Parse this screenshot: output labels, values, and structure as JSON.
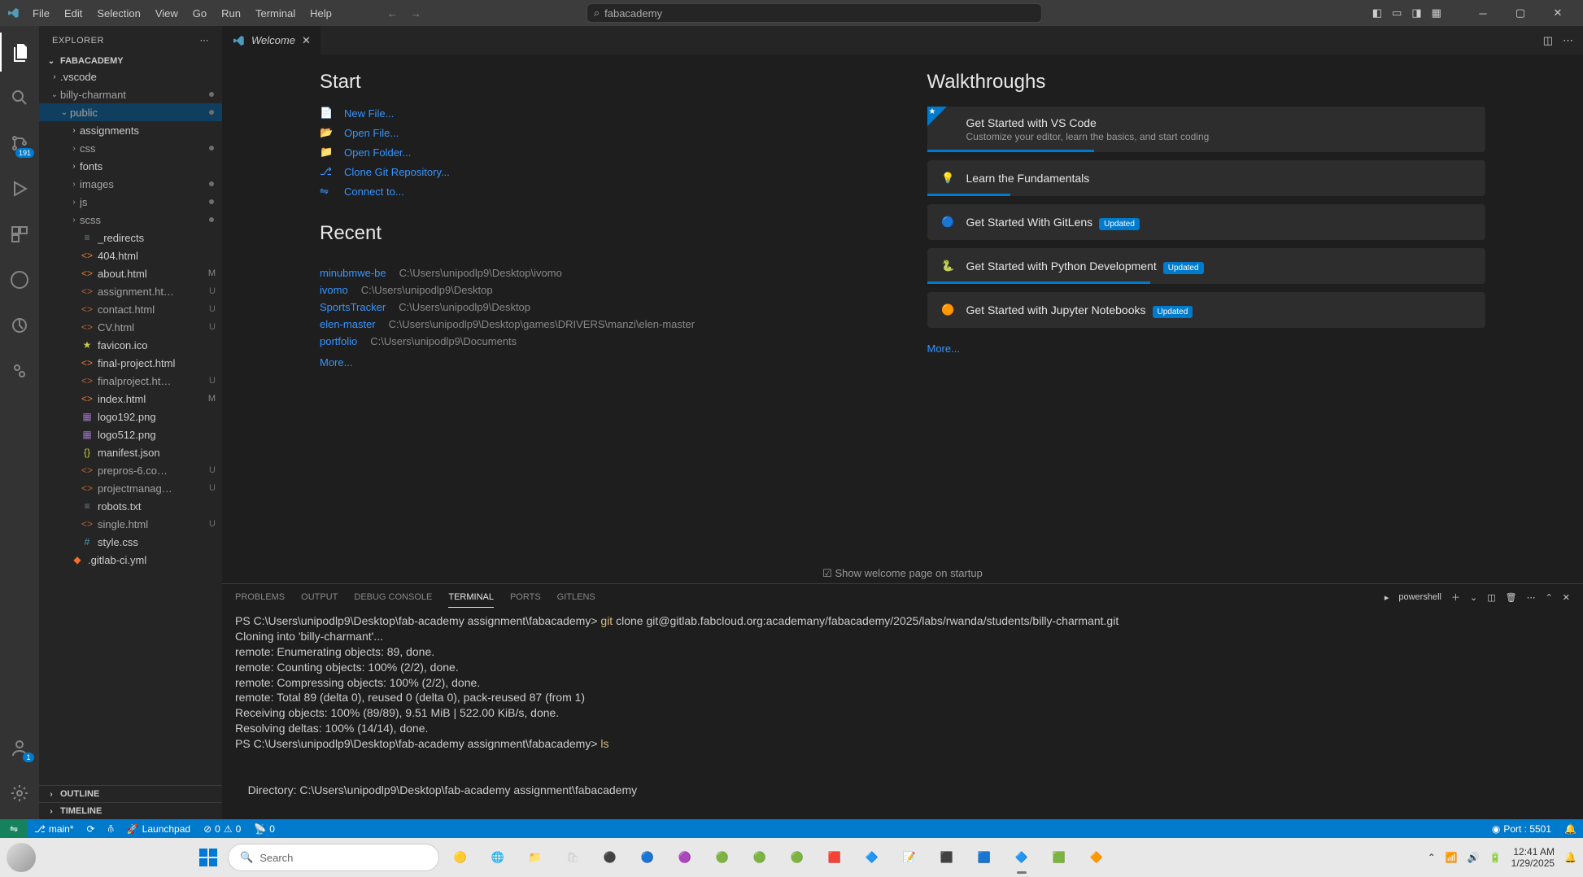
{
  "menu": [
    "File",
    "Edit",
    "Selection",
    "View",
    "Go",
    "Run",
    "Terminal",
    "Help"
  ],
  "search_placeholder": "fabacademy",
  "activity": {
    "items": [
      "explorer",
      "search",
      "source-control",
      "run-debug",
      "extensions",
      "github",
      "gitlens",
      "docker"
    ],
    "scm_badge": "191",
    "account_badge": "1"
  },
  "sidebar": {
    "title": "EXPLORER",
    "project": "FABACADEMY",
    "tree": [
      {
        "indent": 1,
        "chevron": "right",
        "type": "folder",
        "name": ".vscode"
      },
      {
        "indent": 1,
        "chevron": "down",
        "type": "folder",
        "name": "billy-charmant",
        "dot": true,
        "dim": true
      },
      {
        "indent": 2,
        "chevron": "down",
        "type": "folder",
        "name": "public",
        "dot": true,
        "dim": true,
        "selected": true
      },
      {
        "indent": 3,
        "chevron": "right",
        "type": "folder",
        "name": "assignments"
      },
      {
        "indent": 3,
        "chevron": "right",
        "type": "folder",
        "name": "css",
        "dot": true,
        "dim": true
      },
      {
        "indent": 3,
        "chevron": "right",
        "type": "folder",
        "name": "fonts"
      },
      {
        "indent": 3,
        "chevron": "right",
        "type": "folder",
        "name": "images",
        "dot": true,
        "dim": true
      },
      {
        "indent": 3,
        "chevron": "right",
        "type": "folder",
        "name": "js",
        "dot": true,
        "dim": true
      },
      {
        "indent": 3,
        "chevron": "right",
        "type": "folder",
        "name": "scss",
        "dot": true,
        "dim": true
      },
      {
        "indent": 3,
        "type": "file",
        "icon": "txt",
        "name": "_redirects"
      },
      {
        "indent": 3,
        "type": "file",
        "icon": "html",
        "name": "404.html"
      },
      {
        "indent": 3,
        "type": "file",
        "icon": "html",
        "name": "about.html",
        "badge": "M"
      },
      {
        "indent": 3,
        "type": "file",
        "icon": "html",
        "name": "assignment.ht…",
        "badge": "U",
        "dim": true
      },
      {
        "indent": 3,
        "type": "file",
        "icon": "html",
        "name": "contact.html",
        "badge": "U",
        "dim": true
      },
      {
        "indent": 3,
        "type": "file",
        "icon": "html",
        "name": "CV.html",
        "badge": "U",
        "dim": true
      },
      {
        "indent": 3,
        "type": "file",
        "icon": "ico",
        "name": "favicon.ico"
      },
      {
        "indent": 3,
        "type": "file",
        "icon": "html",
        "name": "final-project.html"
      },
      {
        "indent": 3,
        "type": "file",
        "icon": "html",
        "name": "finalproject.ht…",
        "badge": "U",
        "dim": true
      },
      {
        "indent": 3,
        "type": "file",
        "icon": "html",
        "name": "index.html",
        "badge": "M"
      },
      {
        "indent": 3,
        "type": "file",
        "icon": "img",
        "name": "logo192.png"
      },
      {
        "indent": 3,
        "type": "file",
        "icon": "img",
        "name": "logo512.png"
      },
      {
        "indent": 3,
        "type": "file",
        "icon": "json",
        "name": "manifest.json"
      },
      {
        "indent": 3,
        "type": "file",
        "icon": "html",
        "name": "prepros-6.co…",
        "badge": "U",
        "dim": true
      },
      {
        "indent": 3,
        "type": "file",
        "icon": "html",
        "name": "projectmanag…",
        "badge": "U",
        "dim": true
      },
      {
        "indent": 3,
        "type": "file",
        "icon": "txt",
        "name": "robots.txt"
      },
      {
        "indent": 3,
        "type": "file",
        "icon": "html",
        "name": "single.html",
        "badge": "U",
        "dim": true
      },
      {
        "indent": 3,
        "type": "file",
        "icon": "css",
        "name": "style.css"
      },
      {
        "indent": 2,
        "type": "file",
        "icon": "yml",
        "name": ".gitlab-ci.yml"
      }
    ],
    "sections": [
      "OUTLINE",
      "TIMELINE"
    ]
  },
  "tab": {
    "label": "Welcome"
  },
  "welcome": {
    "start_heading": "Start",
    "start_items": [
      {
        "icon": "new-file",
        "label": "New File..."
      },
      {
        "icon": "open-file",
        "label": "Open File..."
      },
      {
        "icon": "open-folder",
        "label": "Open Folder..."
      },
      {
        "icon": "git",
        "label": "Clone Git Repository..."
      },
      {
        "icon": "connect",
        "label": "Connect to..."
      }
    ],
    "recent_heading": "Recent",
    "recent": [
      {
        "name": "minubmwe-be",
        "path": "C:\\Users\\unipodlp9\\Desktop\\ivomo"
      },
      {
        "name": "ivomo",
        "path": "C:\\Users\\unipodlp9\\Desktop"
      },
      {
        "name": "SportsTracker",
        "path": "C:\\Users\\unipodlp9\\Desktop"
      },
      {
        "name": "elen-master",
        "path": "C:\\Users\\unipodlp9\\Desktop\\games\\DRIVERS\\manzi\\elen-master"
      },
      {
        "name": "portfolio",
        "path": "C:\\Users\\unipodlp9\\Documents"
      }
    ],
    "more": "More...",
    "walk_heading": "Walkthroughs",
    "walkthroughs": [
      {
        "title": "Get Started with VS Code",
        "sub": "Customize your editor, learn the basics, and start coding",
        "featured": true,
        "progress": 30
      },
      {
        "title": "Learn the Fundamentals",
        "progress": 15,
        "icon": "bulb"
      },
      {
        "title": "Get Started With GitLens",
        "updated": true,
        "icon": "gitlens"
      },
      {
        "title": "Get Started with Python Development",
        "updated": true,
        "progress": 40,
        "icon": "python"
      },
      {
        "title": "Get Started with Jupyter Notebooks",
        "updated": true,
        "icon": "jupyter"
      }
    ],
    "updated_label": "Updated",
    "checkbox_label": "Show welcome page on startup"
  },
  "panel": {
    "tabs": [
      "PROBLEMS",
      "OUTPUT",
      "DEBUG CONSOLE",
      "TERMINAL",
      "PORTS",
      "GITLENS"
    ],
    "active_tab": "TERMINAL",
    "shell_label": "powershell",
    "terminal_lines": [
      {
        "prompt": "PS C:\\Users\\unipodlp9\\Desktop\\fab-academy assignment\\fabacademy> ",
        "cmd": "git",
        "rest": " clone git@gitlab.fabcloud.org:academany/fabacademy/2025/labs/rwanda/students/billy-charmant.git"
      },
      {
        "text": "Cloning into 'billy-charmant'..."
      },
      {
        "text": "remote: Enumerating objects: 89, done."
      },
      {
        "text": "remote: Counting objects: 100% (2/2), done."
      },
      {
        "text": "remote: Compressing objects: 100% (2/2), done."
      },
      {
        "text": "remote: Total 89 (delta 0), reused 0 (delta 0), pack-reused 87 (from 1)"
      },
      {
        "text": "Receiving objects: 100% (89/89), 9.51 MiB | 522.00 KiB/s, done."
      },
      {
        "text": "Resolving deltas: 100% (14/14), done."
      },
      {
        "prompt": "PS C:\\Users\\unipodlp9\\Desktop\\fab-academy assignment\\fabacademy> ",
        "cmd": "ls"
      },
      {
        "text": ""
      },
      {
        "text": ""
      },
      {
        "text": "    Directory: C:\\Users\\unipodlp9\\Desktop\\fab-academy assignment\\fabacademy"
      }
    ]
  },
  "status": {
    "branch": "main*",
    "launchpad": "Launchpad",
    "errors": "0",
    "warnings": "0",
    "radio": "0",
    "port": "Port : 5501"
  },
  "taskbar": {
    "search_placeholder": "Search",
    "time": "12:41 AM",
    "date": "1/29/2025"
  }
}
